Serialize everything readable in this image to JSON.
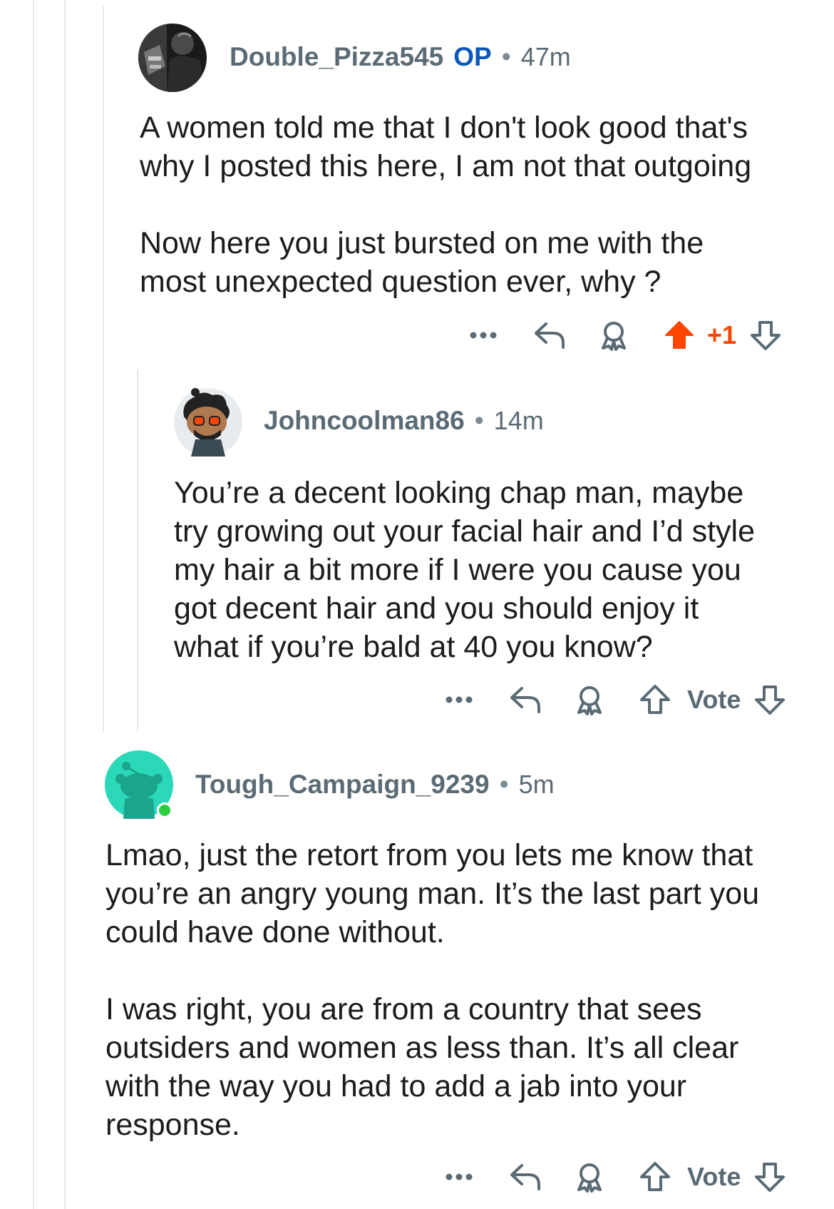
{
  "comments": [
    {
      "username": "Double_Pizza545",
      "op_label": "OP",
      "separator": "•",
      "time": "47m",
      "paragraphs": [
        [
          "A women told me that I don't look good that's",
          "why I posted this here, I am not that outgoing"
        ],
        [
          "Now here you just bursted on me with the",
          "most unexpected question ever, why ?"
        ]
      ],
      "vote": "+1",
      "upvoted": true
    },
    {
      "username": "Johncoolman86",
      "separator": "•",
      "time": "14m",
      "paragraphs": [
        [
          "You’re a decent looking chap man, maybe",
          "try growing out your facial hair and I’d style",
          "my hair a bit more if I were you cause you",
          "got decent hair and you should enjoy it",
          "what if you’re bald at 40 you know?"
        ]
      ],
      "vote": "Vote",
      "upvoted": false
    },
    {
      "username": "Tough_Campaign_9239",
      "separator": "•",
      "time": "5m",
      "online": true,
      "paragraphs": [
        [
          "Lmao, just the retort from you lets me know that",
          "you’re an angry young man. It’s the last part you",
          "could have done without."
        ],
        [
          "I was right, you are from a country that sees",
          "outsiders and women as less than. It’s all clear",
          "with the way you had to add a jab into your",
          "response."
        ]
      ],
      "vote": "Vote",
      "upvoted": false
    }
  ],
  "icons": [
    "more-icon",
    "reply-icon",
    "award-icon",
    "upvote-icon",
    "downvote-icon"
  ],
  "colors": {
    "upvote_active": "#ff4500",
    "username": "#5b6b75",
    "op": "#0b58b8",
    "online": "#2ecc40",
    "snoo_bg": "#2bd9b9"
  }
}
